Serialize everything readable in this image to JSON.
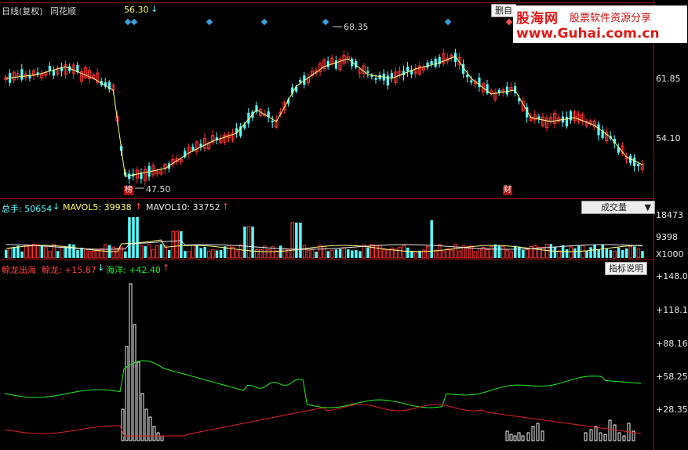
{
  "price_panel": {
    "period_label": "日线(复权)",
    "stock_name": "同花顺",
    "current_price": "56.30",
    "arrow_down": "↓",
    "high_label": "68.35",
    "low_label": "47.50",
    "axis_ticks": [
      "61.85",
      "54.10"
    ],
    "marker_left": "榜",
    "marker_right": "财",
    "tool_button": "删自"
  },
  "volume_panel": {
    "total_label": "总手: 50654",
    "total_arrow": "↓",
    "mavol5_label": "MAVOL5: 39938",
    "mavol5_arrow": "↑",
    "mavol10_label": "MAVOL10: 33752",
    "mavol10_arrow": "↑",
    "dropdown_label": "成交量",
    "dropdown_arrow": "▼",
    "axis_ticks": [
      "18473",
      "9398",
      "X1000"
    ]
  },
  "indicator_panel": {
    "name_label": "鲸龙出海",
    "jinglong_label": "鲸龙: +15.87",
    "jinglong_arrow": "↓",
    "haiyang_label": "海洋: +42.40",
    "haiyang_arrow": "↑",
    "help_button": "指标说明",
    "axis_ticks": [
      "+148.0",
      "+118.1",
      "+88.16",
      "+58.25",
      "+28.35"
    ]
  },
  "watermark": {
    "title": "股海网",
    "subtitle": "股票软件资源分享",
    "url": "www.Guhai.com.cn"
  },
  "colors": {
    "up": "#ff3232",
    "down": "#54ffff",
    "ma": "#ffff80",
    "green_line": "#22ee22",
    "red_line": "#e02020",
    "frame": "#8b1111"
  }
}
